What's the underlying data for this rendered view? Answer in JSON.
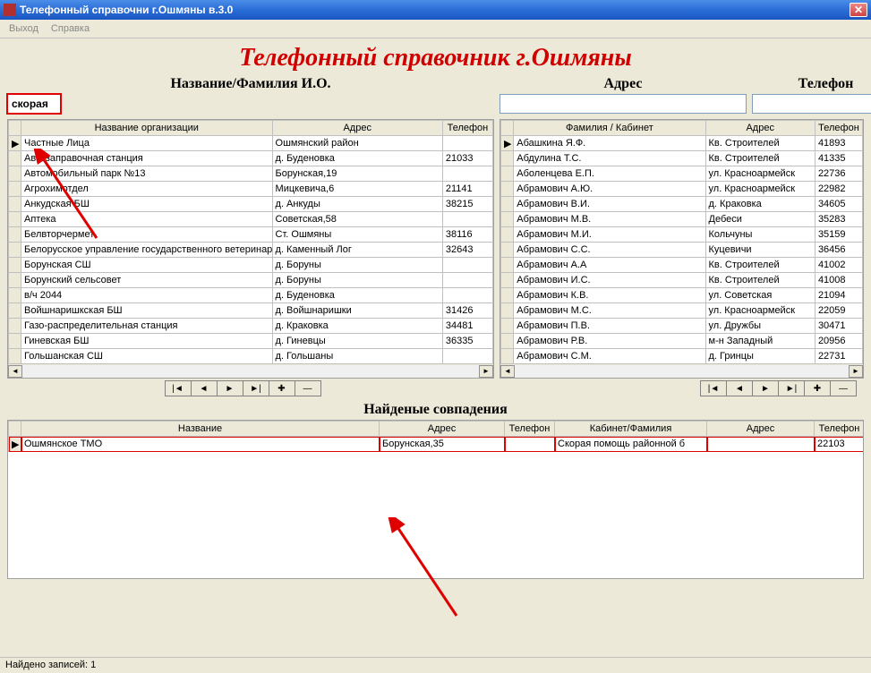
{
  "window": {
    "title": "Телефонный справочни г.Ошмяны в.3.0"
  },
  "menu": {
    "exit": "Выход",
    "help": "Справка"
  },
  "heading": "Телефонный справочник г.Ошмяны",
  "search": {
    "name_label": "Название/Фамилия И.О.",
    "addr_label": "Адрес",
    "phone_label": "Телефон",
    "name_value": "скорая",
    "addr_value": "",
    "phone_value": ""
  },
  "left_grid": {
    "headers": {
      "name": "Название организации",
      "addr": "Адрес",
      "phone": "Телефон"
    },
    "rows": [
      {
        "mark": "▶",
        "name": "Частные Лица",
        "addr": "Ошмянский район",
        "phone": ""
      },
      {
        "mark": "",
        "name": "Автозаправочная станция",
        "addr": "д. Буденовка",
        "phone": "21033"
      },
      {
        "mark": "",
        "name": "Автомобильный парк №13",
        "addr": "Борунская,19",
        "phone": ""
      },
      {
        "mark": "",
        "name": "Агрохимотдел",
        "addr": "Мицкевича,6",
        "phone": "21141"
      },
      {
        "mark": "",
        "name": "Анкудская БШ",
        "addr": "д. Анкуды",
        "phone": "38215"
      },
      {
        "mark": "",
        "name": "Аптека",
        "addr": "Советская,58",
        "phone": ""
      },
      {
        "mark": "",
        "name": "Белвторчермет",
        "addr": "Ст. Ошмяны",
        "phone": "38116"
      },
      {
        "mark": "",
        "name": "Белорусское управление государственного ветеринарн",
        "addr": "д. Каменный Лог",
        "phone": "32643"
      },
      {
        "mark": "",
        "name": "Борунская СШ",
        "addr": "д. Боруны",
        "phone": ""
      },
      {
        "mark": "",
        "name": "Борунский сельсовет",
        "addr": "д. Боруны",
        "phone": ""
      },
      {
        "mark": "",
        "name": "в/ч 2044",
        "addr": "д. Буденовка",
        "phone": ""
      },
      {
        "mark": "",
        "name": "Войшнаришкская БШ",
        "addr": "д. Войшнаришки",
        "phone": "31426"
      },
      {
        "mark": "",
        "name": "Газо-распределительная станция",
        "addr": "д. Краковка",
        "phone": "34481"
      },
      {
        "mark": "",
        "name": "Гиневская БШ",
        "addr": "д. Гиневцы",
        "phone": "36335"
      },
      {
        "mark": "",
        "name": "Гольшанская СШ",
        "addr": "д. Гольшаны",
        "phone": ""
      }
    ]
  },
  "right_grid": {
    "headers": {
      "name": "Фамилия / Кабинет",
      "addr": "Адрес",
      "phone": "Телефон"
    },
    "rows": [
      {
        "mark": "▶",
        "name": "Абашкина Я.Ф.",
        "addr": "Кв. Строителей",
        "phone": "41893"
      },
      {
        "mark": "",
        "name": "Абдулина Т.С.",
        "addr": "Кв. Строителей",
        "phone": "41335"
      },
      {
        "mark": "",
        "name": "Аболенцева Е.П.",
        "addr": "ул. Красноармейск",
        "phone": "22736"
      },
      {
        "mark": "",
        "name": "Абрамович А.Ю.",
        "addr": "ул. Красноармейск",
        "phone": "22982"
      },
      {
        "mark": "",
        "name": "Абрамович  В.И.",
        "addr": "д. Краковка",
        "phone": "34605"
      },
      {
        "mark": "",
        "name": "Абрамович  М.В.",
        "addr": "Дебеси",
        "phone": "35283"
      },
      {
        "mark": "",
        "name": "Абрамович  М.И.",
        "addr": "Кольчуны",
        "phone": "35159"
      },
      {
        "mark": "",
        "name": "Абрамович  С.С.",
        "addr": "Куцевичи",
        "phone": "36456"
      },
      {
        "mark": "",
        "name": "Абрамович А.А",
        "addr": "Кв. Строителей",
        "phone": "41002"
      },
      {
        "mark": "",
        "name": "Абрамович И.С.",
        "addr": "Кв. Строителей",
        "phone": "41008"
      },
      {
        "mark": "",
        "name": "Абрамович К.В.",
        "addr": "ул. Советская",
        "phone": "21094"
      },
      {
        "mark": "",
        "name": "Абрамович М.С.",
        "addr": "ул. Красноармейск",
        "phone": "22059"
      },
      {
        "mark": "",
        "name": "Абрамович П.В.",
        "addr": "ул. Дружбы",
        "phone": "30471"
      },
      {
        "mark": "",
        "name": "Абрамович Р.В.",
        "addr": "м-н Западный",
        "phone": "20956"
      },
      {
        "mark": "",
        "name": "Абрамович С.М.",
        "addr": "д. Гринцы",
        "phone": "22731"
      }
    ]
  },
  "nav": {
    "first": "|◄",
    "prev": "◄",
    "next": "►",
    "last": "►|",
    "add": "✚",
    "del": "—"
  },
  "results": {
    "title": "Найденые совпадения",
    "headers": {
      "name": "Название",
      "addr": "Адрес",
      "phone": "Телефон",
      "cab": "Кабинет/Фамилия",
      "addr2": "Адрес",
      "phone2": "Телефон"
    },
    "rows": [
      {
        "mark": "▶",
        "name": "Ошмянское ТМО",
        "addr": "Борунская,35",
        "phone": "",
        "cab": "Скорая помощь районной б",
        "addr2": "",
        "phone2": "22103"
      }
    ]
  },
  "status": "Найдено записей: 1"
}
